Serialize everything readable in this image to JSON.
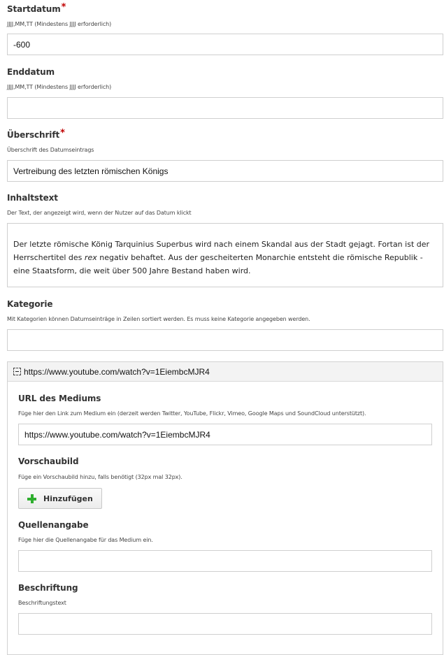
{
  "start": {
    "label": "Startdatum",
    "required_mark": "*",
    "hint": "JJJJ,MM,TT (Mindestens JJJJ erforderlich)",
    "value": "-600"
  },
  "end": {
    "label": "Enddatum",
    "hint": "JJJJ,MM,TT (Mindestens JJJJ erforderlich)",
    "value": ""
  },
  "headline": {
    "label": "Überschrift",
    "required_mark": "*",
    "hint": "Überschrift des Datumseintrags",
    "value": "Vertreibung des letzten römischen Königs"
  },
  "body": {
    "label": "Inhaltstext",
    "hint": "Der Text, der angezeigt wird, wenn der Nutzer auf das Datum klickt",
    "text_before_em": "Der letzte römische König Tarquinius Superbus wird nach einem Skandal aus der Stadt gejagt. Fortan ist der Herrschertitel des ",
    "text_em": "rex",
    "text_after_em": " negativ behaftet. Aus der gescheiterten Monarchie entsteht die römische Republik - eine Staatsform, die weit über 500 Jahre Bestand haben wird."
  },
  "category": {
    "label": "Kategorie",
    "hint": "Mit Kategorien können Datumseinträge in Zeilen sortiert werden. Es muss keine Kategorie angegeben werden.",
    "value": ""
  },
  "media": {
    "panel_title": "https://www.youtube.com/watch?v=1EiembcMJR4",
    "url_label": "URL des Mediums",
    "url_hint": "Füge hier den Link zum Medium ein (derzeit werden Twitter, YouTube, Flickr, Vimeo, Google Maps und SoundCloud unterstützt).",
    "url_value": "https://www.youtube.com/watch?v=1EiembcMJR4",
    "thumb_label": "Vorschaubild",
    "thumb_hint": "Füge ein Vorschaubild hinzu, falls benötigt (32px mal 32px).",
    "add_button": "Hinzufügen",
    "source_label": "Quellenangabe",
    "source_hint": "Füge hier die Quellenangabe für das Medium ein.",
    "source_value": "",
    "caption_label": "Beschriftung",
    "caption_hint": "Beschriftungstext",
    "caption_value": ""
  }
}
